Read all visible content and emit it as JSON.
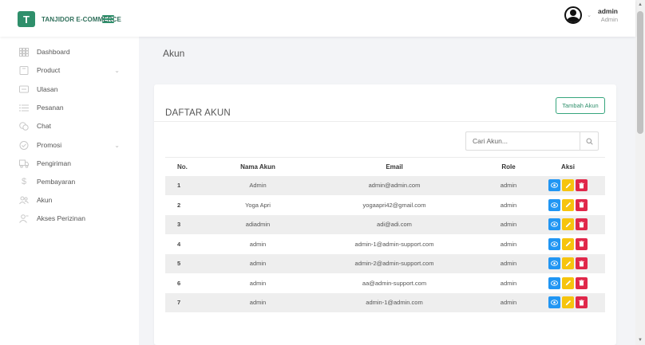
{
  "brand": {
    "logo_text": "T",
    "name": "TANJIDOR E-COMMERCE"
  },
  "user": {
    "name": "admin",
    "role": "Admin"
  },
  "sidebar": {
    "items": [
      {
        "label": "Dashboard",
        "icon": "grid-icon",
        "has_caret": false
      },
      {
        "label": "Product",
        "icon": "box-icon",
        "has_caret": true
      },
      {
        "label": "Ulasan",
        "icon": "message-icon",
        "has_caret": false
      },
      {
        "label": "Pesanan",
        "icon": "list-icon",
        "has_caret": false
      },
      {
        "label": "Chat",
        "icon": "chat-icon",
        "has_caret": false
      },
      {
        "label": "Promosi",
        "icon": "check-circle-icon",
        "has_caret": true
      },
      {
        "label": "Pengiriman",
        "icon": "truck-icon",
        "has_caret": false
      },
      {
        "label": "Pembayaran",
        "icon": "dollar-icon",
        "has_caret": false
      },
      {
        "label": "Akun",
        "icon": "users-icon",
        "has_caret": false
      },
      {
        "label": "Akses Perizinan",
        "icon": "user-key-icon",
        "has_caret": false
      }
    ]
  },
  "page": {
    "title": "Akun"
  },
  "card": {
    "title": "DAFTAR AKUN",
    "add_button": "Tambah Akun",
    "search_placeholder": "Cari Akun..."
  },
  "table": {
    "headers": {
      "no": "No.",
      "name": "Nama Akun",
      "email": "Email",
      "role": "Role",
      "actions": "Aksi"
    },
    "rows": [
      {
        "no": "1",
        "name": "Admin",
        "email": "admin@admin.com",
        "role": "admin"
      },
      {
        "no": "2",
        "name": "Yoga Apri",
        "email": "yogaapri42@gmail.com",
        "role": "admin"
      },
      {
        "no": "3",
        "name": "adiadmin",
        "email": "adi@adi.com",
        "role": "admin"
      },
      {
        "no": "4",
        "name": "admin",
        "email": "admin-1@admin-support.com",
        "role": "admin"
      },
      {
        "no": "5",
        "name": "admin",
        "email": "admin-2@admin-support.com",
        "role": "admin"
      },
      {
        "no": "6",
        "name": "admin",
        "email": "aa@admin-support.com",
        "role": "admin"
      },
      {
        "no": "7",
        "name": "admin",
        "email": "admin-1@admin.com",
        "role": "admin"
      }
    ]
  },
  "colors": {
    "brand": "#2f8f6b",
    "view": "#2196f3",
    "edit": "#f6c40e",
    "delete": "#e0284a"
  }
}
